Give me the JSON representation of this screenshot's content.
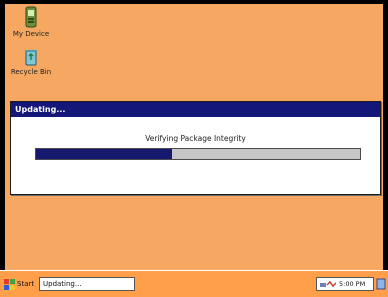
{
  "desktop": {
    "icons": [
      {
        "label": "My Device",
        "icon": "handheld-device-icon"
      },
      {
        "label": "Recycle Bin",
        "icon": "recycle-bin-icon"
      }
    ]
  },
  "dialog": {
    "title": "Updating...",
    "status": "Verifying Package Integrity",
    "progress": 0.42
  },
  "taskbar": {
    "start_label": "Start",
    "task_label": "Updating...",
    "clock": "5:00 PM"
  },
  "colors": {
    "desktop_bg": "#f6a862",
    "title_bar": "#141679",
    "progress_fill": "#17196e",
    "progress_track": "#c6c6c6",
    "taskbar_bg": "#ff9f4a"
  }
}
